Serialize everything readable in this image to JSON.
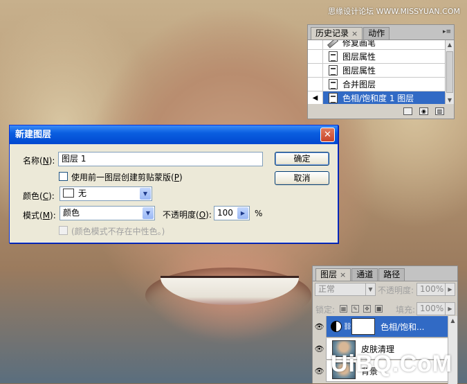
{
  "watermarks": {
    "top": "思缘设计论坛 WWW.MISSYUAN.COM",
    "bottom": "UiBQ.CoM"
  },
  "history_panel": {
    "tabs": [
      "历史记录",
      "动作"
    ],
    "close_glyph": "×",
    "menu_glyph": "▸≡",
    "items": [
      {
        "label": "修复画笔",
        "icon": "healing-brush-icon"
      },
      {
        "label": "图层属性",
        "icon": "history-state-icon"
      },
      {
        "label": "图层属性",
        "icon": "history-state-icon"
      },
      {
        "label": "合并图层",
        "icon": "history-state-icon"
      },
      {
        "label": "色相/饱和度 1 图层",
        "icon": "history-state-icon",
        "selected": true
      }
    ],
    "footer_icons": [
      "new-document-from-state-icon",
      "snapshot-camera-icon",
      "trash-icon"
    ]
  },
  "dialog": {
    "title": "新建图层",
    "close_glyph": "✕",
    "name_label": "名称(",
    "name_key": "N",
    "name_label_end": "):",
    "name_value": "图层 1",
    "clip_checkbox_label": "使用前一图层创建剪贴蒙版(",
    "clip_key": "P",
    "clip_end": ")",
    "color_label": "颜色(",
    "color_key": "C",
    "color_label_end": "):",
    "color_value": "无",
    "mode_label": "模式(",
    "mode_key": "M",
    "mode_label_end": "):",
    "mode_value": "颜色",
    "opacity_label": "不透明度(",
    "opacity_key": "O",
    "opacity_label_end": "):",
    "opacity_value": "100",
    "opacity_unit": "%",
    "neutral_label": "(颜色模式不存在中性色。)",
    "ok_label": "确定",
    "cancel_label": "取消",
    "dropdown_glyph": "▼",
    "spin_glyph": "▶"
  },
  "layers_panel": {
    "tabs": [
      "图层",
      "通道",
      "路径"
    ],
    "close_glyph": "×",
    "blend_mode": "正常",
    "opacity_label": "不透明度:",
    "opacity_value": "100%",
    "lock_label": "锁定:",
    "fill_label": "填充:",
    "fill_value": "100%",
    "eye_glyph": "👁",
    "layers": [
      {
        "name": "色相/饱和...",
        "type": "adjustment",
        "selected": true
      },
      {
        "name": "皮肤清理",
        "type": "photo"
      },
      {
        "name": "背景",
        "type": "photo"
      }
    ]
  }
}
